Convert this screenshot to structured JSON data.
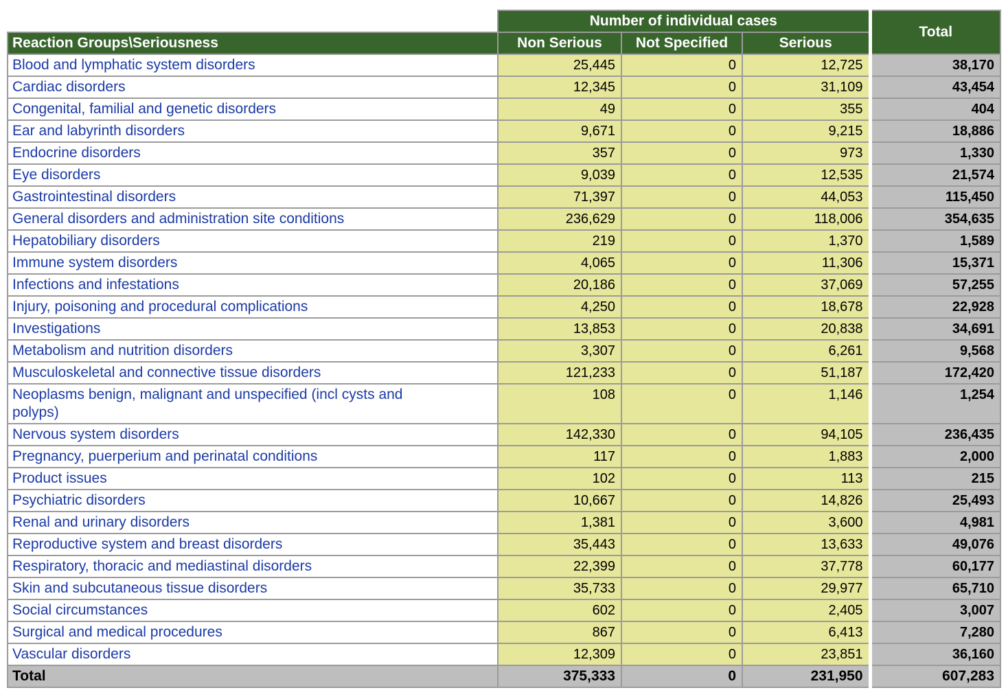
{
  "header": {
    "group_header": "Number of individual cases",
    "row_header": "Reaction Groups\\Seriousness",
    "columns": [
      "Non Serious",
      "Not Specified",
      "Serious"
    ],
    "total_header": "Total"
  },
  "table": {
    "rows": [
      {
        "label": "Blood and lymphatic system disorders",
        "non_serious": "25,445",
        "not_specified": "0",
        "serious": "12,725",
        "total": "38,170"
      },
      {
        "label": "Cardiac disorders",
        "non_serious": "12,345",
        "not_specified": "0",
        "serious": "31,109",
        "total": "43,454"
      },
      {
        "label": "Congenital, familial and genetic disorders",
        "non_serious": "49",
        "not_specified": "0",
        "serious": "355",
        "total": "404"
      },
      {
        "label": "Ear and labyrinth disorders",
        "non_serious": "9,671",
        "not_specified": "0",
        "serious": "9,215",
        "total": "18,886"
      },
      {
        "label": "Endocrine disorders",
        "non_serious": "357",
        "not_specified": "0",
        "serious": "973",
        "total": "1,330"
      },
      {
        "label": "Eye disorders",
        "non_serious": "9,039",
        "not_specified": "0",
        "serious": "12,535",
        "total": "21,574"
      },
      {
        "label": "Gastrointestinal disorders",
        "non_serious": "71,397",
        "not_specified": "0",
        "serious": "44,053",
        "total": "115,450"
      },
      {
        "label": "General disorders and administration site conditions",
        "non_serious": "236,629",
        "not_specified": "0",
        "serious": "118,006",
        "total": "354,635"
      },
      {
        "label": "Hepatobiliary disorders",
        "non_serious": "219",
        "not_specified": "0",
        "serious": "1,370",
        "total": "1,589"
      },
      {
        "label": "Immune system disorders",
        "non_serious": "4,065",
        "not_specified": "0",
        "serious": "11,306",
        "total": "15,371"
      },
      {
        "label": "Infections and infestations",
        "non_serious": "20,186",
        "not_specified": "0",
        "serious": "37,069",
        "total": "57,255"
      },
      {
        "label": "Injury, poisoning and procedural complications",
        "non_serious": "4,250",
        "not_specified": "0",
        "serious": "18,678",
        "total": "22,928"
      },
      {
        "label": "Investigations",
        "non_serious": "13,853",
        "not_specified": "0",
        "serious": "20,838",
        "total": "34,691"
      },
      {
        "label": "Metabolism and nutrition disorders",
        "non_serious": "3,307",
        "not_specified": "0",
        "serious": "6,261",
        "total": "9,568"
      },
      {
        "label": "Musculoskeletal and connective tissue disorders",
        "non_serious": "121,233",
        "not_specified": "0",
        "serious": "51,187",
        "total": "172,420"
      },
      {
        "label": "Neoplasms benign, malignant and unspecified (incl cysts and polyps)",
        "non_serious": "108",
        "not_specified": "0",
        "serious": "1,146",
        "total": "1,254"
      },
      {
        "label": "Nervous system disorders",
        "non_serious": "142,330",
        "not_specified": "0",
        "serious": "94,105",
        "total": "236,435"
      },
      {
        "label": "Pregnancy, puerperium and perinatal conditions",
        "non_serious": "117",
        "not_specified": "0",
        "serious": "1,883",
        "total": "2,000"
      },
      {
        "label": "Product issues",
        "non_serious": "102",
        "not_specified": "0",
        "serious": "113",
        "total": "215"
      },
      {
        "label": "Psychiatric disorders",
        "non_serious": "10,667",
        "not_specified": "0",
        "serious": "14,826",
        "total": "25,493"
      },
      {
        "label": "Renal and urinary disorders",
        "non_serious": "1,381",
        "not_specified": "0",
        "serious": "3,600",
        "total": "4,981"
      },
      {
        "label": "Reproductive system and breast disorders",
        "non_serious": "35,443",
        "not_specified": "0",
        "serious": "13,633",
        "total": "49,076"
      },
      {
        "label": "Respiratory, thoracic and mediastinal disorders",
        "non_serious": "22,399",
        "not_specified": "0",
        "serious": "37,778",
        "total": "60,177"
      },
      {
        "label": "Skin and subcutaneous tissue disorders",
        "non_serious": "35,733",
        "not_specified": "0",
        "serious": "29,977",
        "total": "65,710"
      },
      {
        "label": "Social circumstances",
        "non_serious": "602",
        "not_specified": "0",
        "serious": "2,405",
        "total": "3,007"
      },
      {
        "label": "Surgical and medical procedures",
        "non_serious": "867",
        "not_specified": "0",
        "serious": "6,413",
        "total": "7,280"
      },
      {
        "label": "Vascular disorders",
        "non_serious": "12,309",
        "not_specified": "0",
        "serious": "23,851",
        "total": "36,160"
      }
    ],
    "total_row": {
      "label": "Total",
      "non_serious": "375,333",
      "not_specified": "0",
      "serious": "231,950",
      "total": "607,283"
    }
  },
  "colors": {
    "header_green": "#38652c",
    "cell_yellow": "#e7e79c",
    "cell_gray": "#bebebe",
    "border_gray": "#9b9b9b",
    "label_blue": "#1b3aa6",
    "header_text": "#ffffff"
  }
}
